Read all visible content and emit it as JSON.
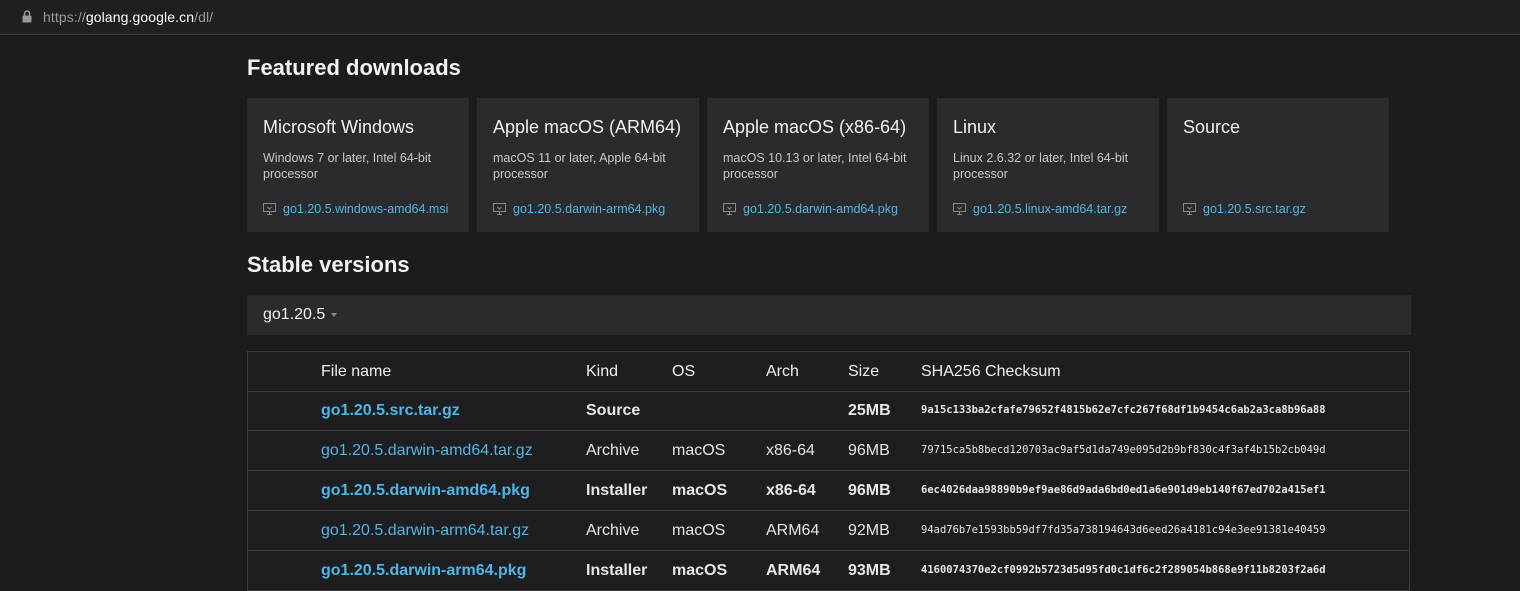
{
  "browser": {
    "url_scheme": "https://",
    "url_host": "golang.google.cn",
    "url_path": "/dl/"
  },
  "featured": {
    "title": "Featured downloads",
    "cards": [
      {
        "title": "Microsoft Windows",
        "desc": "Windows 7 or later, Intel 64-bit processor",
        "file": "go1.20.5.windows-amd64.msi"
      },
      {
        "title": "Apple macOS (ARM64)",
        "desc": "macOS 11 or later, Apple 64-bit processor",
        "file": "go1.20.5.darwin-arm64.pkg"
      },
      {
        "title": "Apple macOS (x86-64)",
        "desc": "macOS 10.13 or later, Intel 64-bit processor",
        "file": "go1.20.5.darwin-amd64.pkg"
      },
      {
        "title": "Linux",
        "desc": "Linux 2.6.32 or later, Intel 64-bit processor",
        "file": "go1.20.5.linux-amd64.tar.gz"
      },
      {
        "title": "Source",
        "desc": "",
        "file": "go1.20.5.src.tar.gz"
      }
    ]
  },
  "stable": {
    "title": "Stable versions",
    "version": "go1.20.5"
  },
  "table": {
    "headers": {
      "file": "File name",
      "kind": "Kind",
      "os": "OS",
      "arch": "Arch",
      "size": "Size",
      "checksum": "SHA256 Checksum"
    },
    "rows": [
      {
        "file": "go1.20.5.src.tar.gz",
        "kind": "Source",
        "os": "",
        "arch": "",
        "size": "25MB",
        "checksum": "9a15c133ba2cfafe79652f4815b62e7cfc267f68df1b9454c6ab2a3ca8b96a88",
        "highlight": true
      },
      {
        "file": "go1.20.5.darwin-amd64.tar.gz",
        "kind": "Archive",
        "os": "macOS",
        "arch": "x86-64",
        "size": "96MB",
        "checksum": "79715ca5b8becd120703ac9af5d1da749e095d2b9bf830c4f3af4b15b2cb049d",
        "highlight": false
      },
      {
        "file": "go1.20.5.darwin-amd64.pkg",
        "kind": "Installer",
        "os": "macOS",
        "arch": "x86-64",
        "size": "96MB",
        "checksum": "6ec4026daa98890b9ef9ae86d9ada6bd0ed1a6e901d9eb140f67ed702a415ef1",
        "highlight": true
      },
      {
        "file": "go1.20.5.darwin-arm64.tar.gz",
        "kind": "Archive",
        "os": "macOS",
        "arch": "ARM64",
        "size": "92MB",
        "checksum": "94ad76b7e1593bb59df7fd35a738194643d6eed26a4181c94e3ee91381e40459",
        "highlight": false
      },
      {
        "file": "go1.20.5.darwin-arm64.pkg",
        "kind": "Installer",
        "os": "macOS",
        "arch": "ARM64",
        "size": "93MB",
        "checksum": "4160074370e2cf0992b5723d5d95fd0c1df6c2f289054b868e9f11b8203f2a6d",
        "highlight": true
      }
    ]
  },
  "colors": {
    "link": "#4fb5e6",
    "background": "#1c1c1e",
    "card": "#2b2b2d"
  }
}
